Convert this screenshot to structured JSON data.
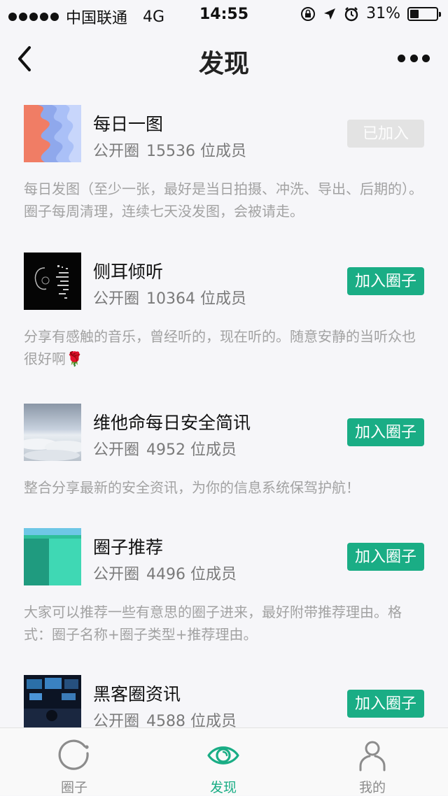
{
  "status_bar": {
    "carrier": "中国联通",
    "network": "4G",
    "time": "14:55",
    "battery": "31%"
  },
  "nav": {
    "title": "发现",
    "back_icon": "chevron-left-icon",
    "more_icon": "more-dots-icon"
  },
  "circles": [
    {
      "name": "每日一图",
      "type": "公开圈",
      "members": "15536 位成员",
      "button": "已加入",
      "joined": true,
      "description": "每日发图（至少一张，最好是当日拍摄、冲洗、导出、后期的）。圈子每周清理，连续七天没发图，会被请走。"
    },
    {
      "name": "侧耳倾听",
      "type": "公开圈",
      "members": "10364 位成员",
      "button": "加入圈子",
      "joined": false,
      "description": "分享有感触的音乐，曾经听的，现在听的。随意安静的当听众也很好啊🌹"
    },
    {
      "name": "维他命每日安全简讯",
      "type": "公开圈",
      "members": "4952 位成员",
      "button": "加入圈子",
      "joined": false,
      "description": "整合分享最新的安全资讯，为你的信息系统保驾护航！"
    },
    {
      "name": "圈子推荐",
      "type": "公开圈",
      "members": "4496 位成员",
      "button": "加入圈子",
      "joined": false,
      "description": "大家可以推荐一些有意思的圈子进来，最好附带推荐理由。格式：圈子名称+圈子类型+推荐理由。"
    },
    {
      "name": "黑客圈资讯",
      "type": "公开圈",
      "members": "4588 位成员",
      "button": "加入圈子",
      "joined": false,
      "description": ""
    }
  ],
  "tabs": [
    {
      "label": "圈子",
      "icon": "circle-icon",
      "active": false
    },
    {
      "label": "发现",
      "icon": "eye-icon",
      "active": true
    },
    {
      "label": "我的",
      "icon": "person-icon",
      "active": false
    }
  ],
  "colors": {
    "accent": "#1aad85",
    "joined_button": "#e3e3e3",
    "background": "#f6f6f9"
  }
}
